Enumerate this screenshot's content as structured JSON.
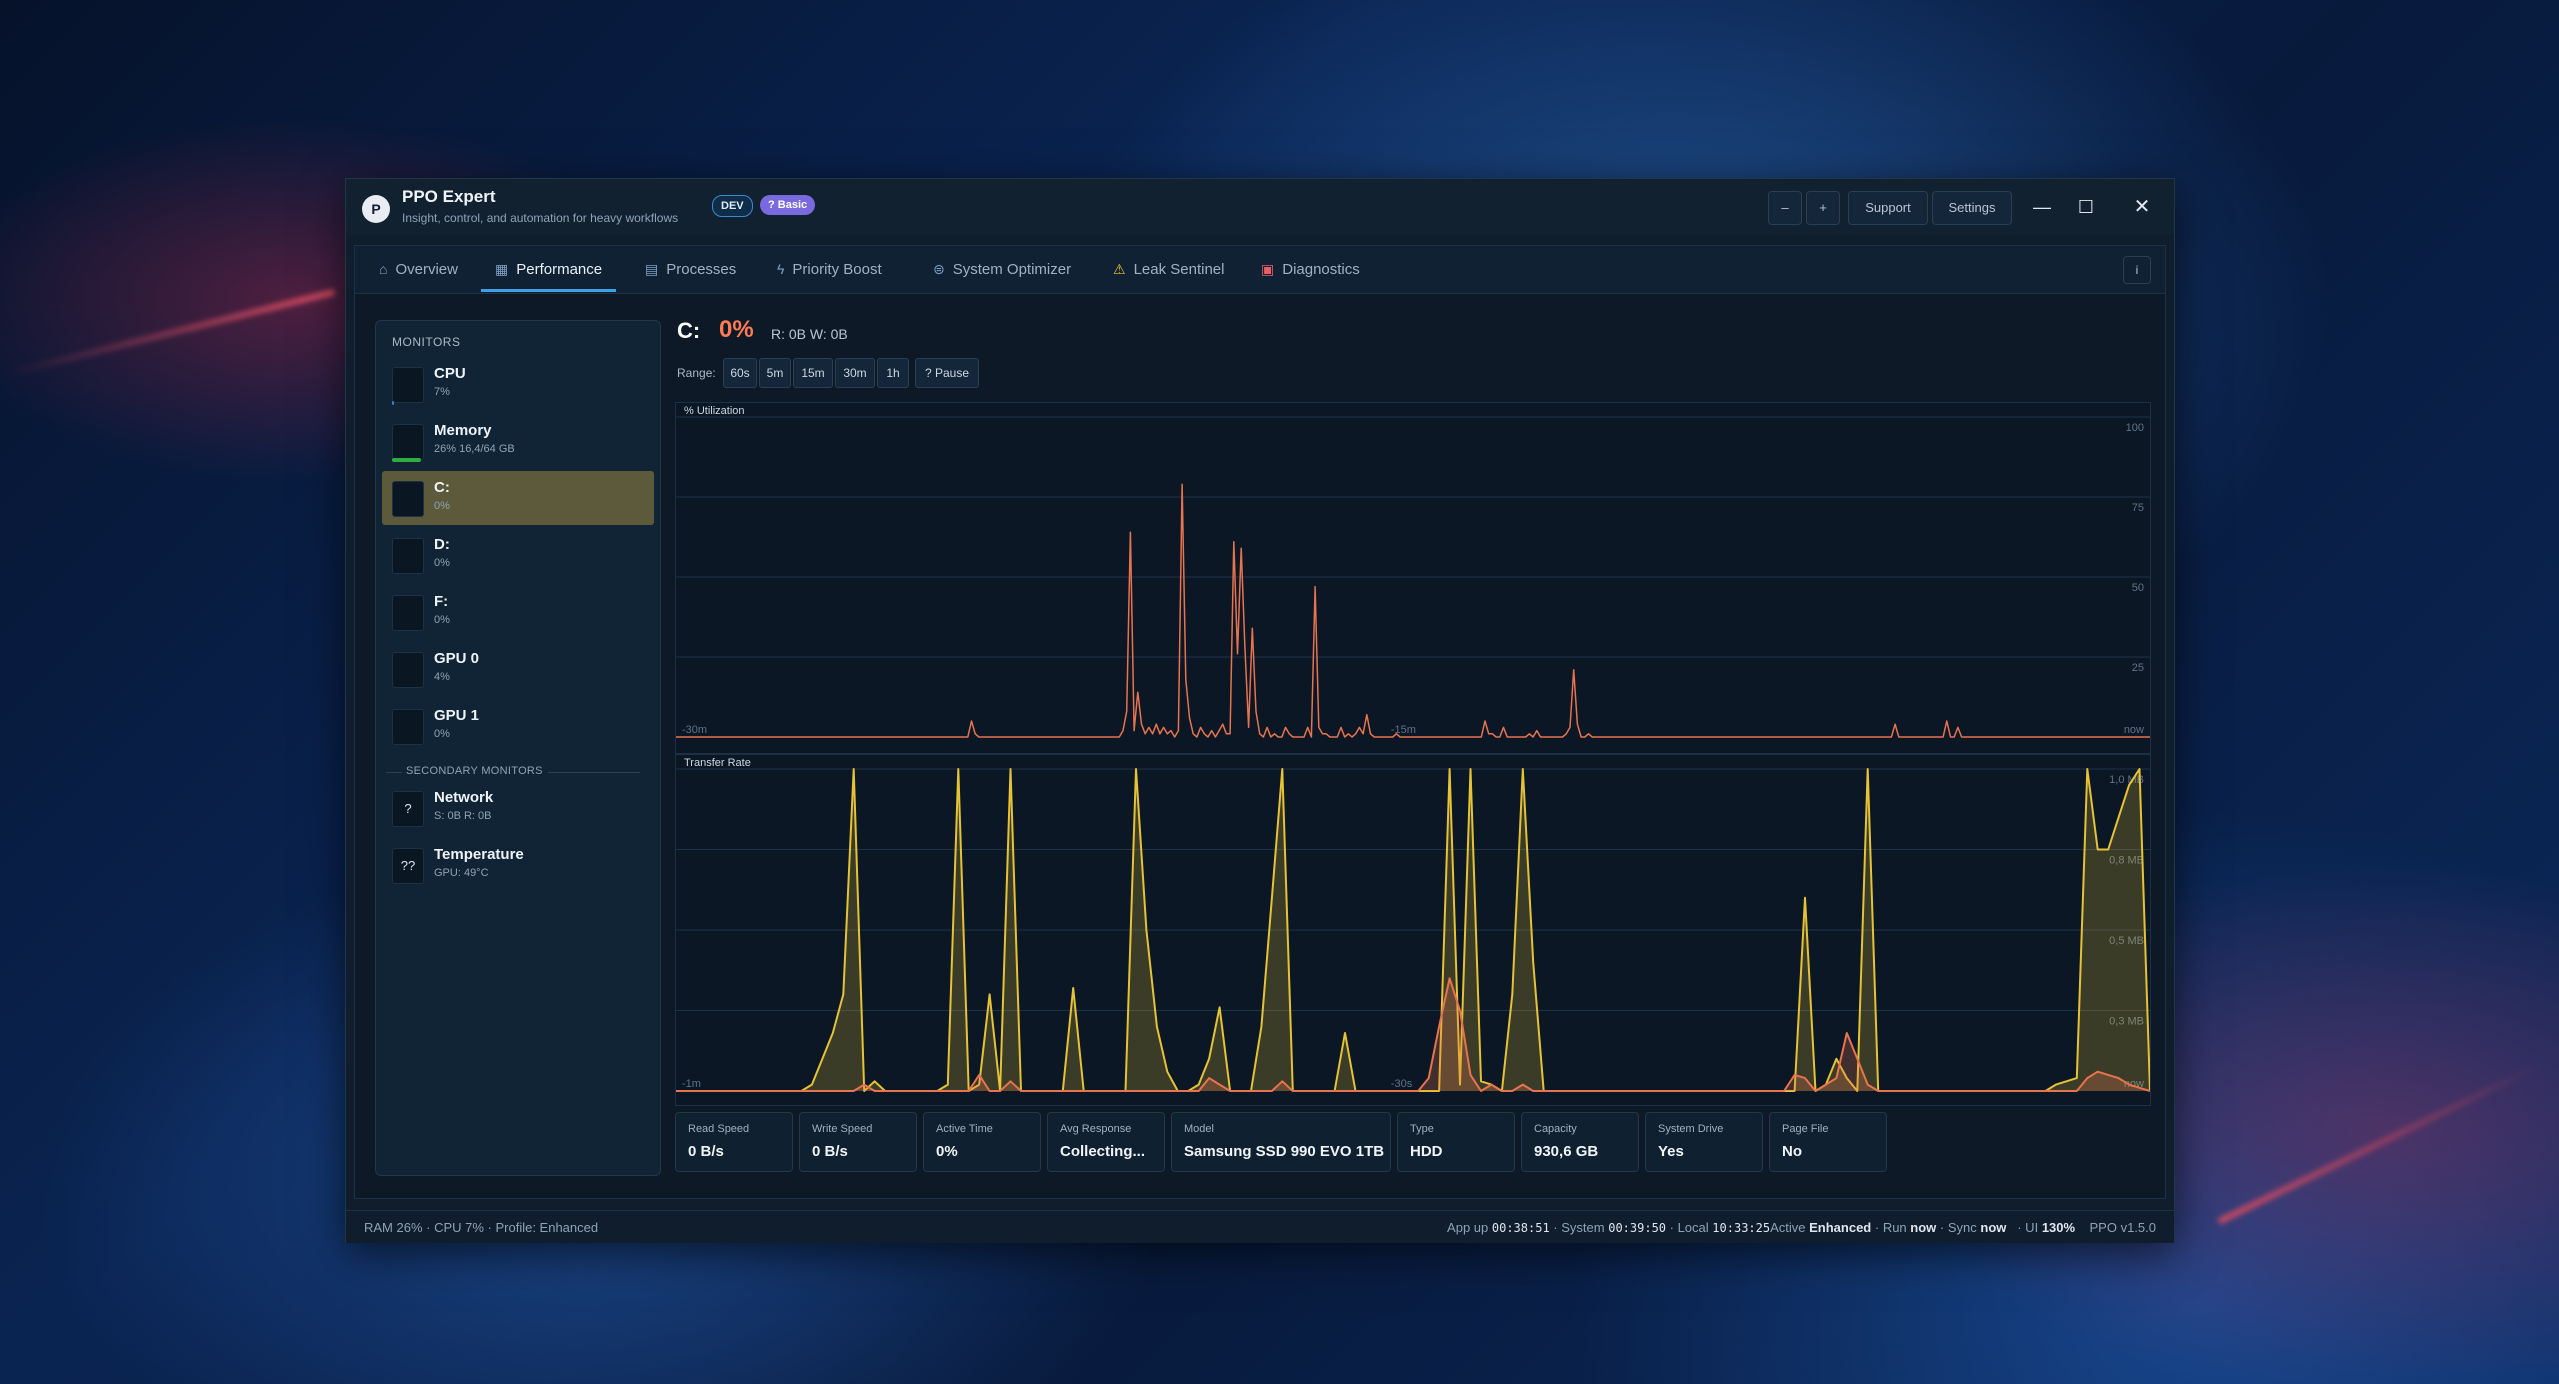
{
  "window": {
    "app_title": "PPO Expert",
    "subtitle": "Insight, control, and automation for heavy workflows",
    "logo_letter": "P",
    "badges": {
      "dev": "DEV",
      "basic": "? Basic"
    },
    "toolbar": {
      "zoom_out": "–",
      "zoom_in": "+",
      "support": "Support",
      "settings": "Settings"
    },
    "controls": {
      "minimize": "—",
      "maximize": "☐",
      "close": "✕"
    }
  },
  "tabs": [
    {
      "label": "Overview",
      "icon": "home-icon",
      "glyph": "⌂"
    },
    {
      "label": "Performance",
      "icon": "chart-icon",
      "glyph": "▦"
    },
    {
      "label": "Processes",
      "icon": "document-icon",
      "glyph": "▤"
    },
    {
      "label": "Priority Boost",
      "icon": "bolt-icon",
      "glyph": "ϟ"
    },
    {
      "label": "System Optimizer",
      "icon": "gamepad-icon",
      "glyph": "⊜"
    },
    {
      "label": "Leak Sentinel",
      "icon": "warning-icon",
      "glyph": "⚠"
    },
    {
      "label": "Diagnostics",
      "icon": "toolbox-icon",
      "glyph": "▣"
    }
  ],
  "info_button": "i",
  "sidebar": {
    "heading": "MONITORS",
    "monitors": [
      {
        "name": "CPU",
        "value": "7%",
        "bar_fraction": 0.07,
        "bar_color": "#3a7bd5"
      },
      {
        "name": "Memory",
        "value": "26%  16,4/64 GB",
        "bar_fraction": 0.9,
        "bar_color": "#2fae3f"
      },
      {
        "name": "C:",
        "value": "0%",
        "selected": true
      },
      {
        "name": "D:",
        "value": "0%"
      },
      {
        "name": "F:",
        "value": "0%"
      },
      {
        "name": "GPU 0",
        "value": "4%"
      },
      {
        "name": "GPU 1",
        "value": "0%"
      }
    ],
    "secondary_heading": "SECONDARY MONITORS",
    "secondary": [
      {
        "name": "Network",
        "value": "S: 0B  R: 0B",
        "glyph": "?"
      },
      {
        "name": "Temperature",
        "value": "GPU: 49°C",
        "glyph": "??"
      }
    ]
  },
  "detail": {
    "drive": "C:",
    "percent": "0%",
    "rw": "R: 0B   W: 0B",
    "range_label": "Range:",
    "ranges": [
      "60s",
      "5m",
      "15m",
      "30m",
      "1h",
      "? Pause"
    ]
  },
  "colors": {
    "utilization": "#e8734f",
    "transfer": "#e6c235",
    "accent": "#3ea0e6"
  },
  "chart_data": [
    {
      "type": "line",
      "title": "% Utilization",
      "ylim": [
        0,
        100
      ],
      "y_ticks": [
        "100",
        "75",
        "50",
        "25"
      ],
      "x_labels": [
        "-30m",
        "-15m",
        "now"
      ],
      "series": [
        {
          "values": [
            0,
            0,
            0,
            0,
            0,
            0,
            0,
            0,
            0,
            0,
            0,
            0,
            0,
            0,
            0,
            0,
            0,
            0,
            0,
            0,
            0,
            0,
            0,
            0,
            0,
            0,
            0,
            0,
            0,
            0,
            0,
            0,
            0,
            0,
            0,
            0,
            0,
            0,
            0,
            0,
            0,
            0,
            0,
            0,
            0,
            0,
            0,
            0,
            0,
            0,
            0,
            0,
            0,
            0,
            0,
            0,
            0,
            0,
            0,
            0,
            0,
            0,
            0,
            0,
            0,
            0,
            0,
            0,
            0,
            0,
            0,
            0,
            0,
            0,
            0,
            0,
            0,
            0,
            0,
            0,
            5,
            1,
            0,
            0,
            0,
            0,
            0,
            0,
            0,
            0,
            0,
            0,
            0,
            0,
            0,
            0,
            0,
            0,
            0,
            0,
            0,
            0,
            0,
            0,
            0,
            0,
            0,
            0,
            0,
            0,
            0,
            0,
            0,
            0,
            0,
            0,
            0,
            0,
            0,
            0,
            0,
            2,
            8,
            64,
            2,
            14,
            4,
            1,
            3,
            1,
            4,
            1,
            3,
            1,
            2,
            0,
            2,
            79,
            18,
            6,
            1,
            0,
            3,
            1,
            0,
            2,
            0,
            2,
            4,
            1,
            1,
            61,
            26,
            59,
            28,
            3,
            34,
            8,
            1,
            0,
            3,
            0,
            1,
            0,
            0,
            3,
            1,
            0,
            0,
            0,
            0,
            3,
            0,
            47,
            3,
            1,
            1,
            0,
            0,
            0,
            3,
            0,
            1,
            0,
            1,
            3,
            1,
            7,
            1,
            0,
            0,
            0,
            0,
            0,
            0,
            1,
            0,
            0,
            0,
            0,
            0,
            0,
            0,
            0,
            0,
            0,
            0,
            0,
            0,
            0,
            0,
            0,
            0,
            0,
            0,
            0,
            0,
            0,
            0,
            5,
            1,
            1,
            0,
            0,
            3,
            0,
            0,
            0,
            0,
            0,
            0,
            1,
            0,
            2,
            0,
            0,
            0,
            0,
            0,
            0,
            0,
            1,
            3,
            21,
            4,
            0,
            0,
            1,
            0,
            0,
            0,
            0,
            0,
            0,
            0,
            0,
            0,
            0,
            0,
            0,
            0,
            0,
            0,
            0,
            0,
            0,
            0,
            0,
            0,
            0,
            0,
            0,
            0,
            0,
            0,
            0,
            0,
            0,
            0,
            0,
            0,
            0,
            0,
            0,
            0,
            0,
            0,
            0,
            0,
            0,
            0,
            0,
            0,
            0,
            0,
            0,
            0,
            0,
            0,
            0,
            0,
            0,
            0,
            0,
            0,
            0,
            0,
            0,
            0,
            0,
            0,
            0,
            0,
            0,
            0,
            0,
            0,
            0,
            0,
            0,
            0,
            0,
            0,
            0,
            0,
            0,
            0,
            0,
            0,
            0,
            4,
            0,
            0,
            0,
            0,
            0,
            0,
            0,
            0,
            0,
            0,
            0,
            0,
            0,
            5,
            0,
            0,
            3,
            0,
            0,
            0,
            0,
            0,
            0,
            0,
            0,
            0,
            0,
            0,
            0,
            0,
            0,
            0,
            0,
            0,
            0,
            0,
            0,
            0,
            0,
            0,
            0,
            0,
            0,
            0,
            0,
            0,
            0,
            0,
            0,
            0,
            0,
            0,
            0,
            0,
            0,
            0,
            0,
            0,
            0,
            0,
            0,
            0,
            0,
            0,
            0,
            0,
            0,
            0,
            0
          ]
        }
      ]
    },
    {
      "type": "area",
      "title": "Transfer Rate",
      "ylim": [
        0,
        1.0
      ],
      "y_ticks": [
        "1,0 MB",
        "0,8 MB",
        "0,5 MB",
        "0,3 MB"
      ],
      "x_labels": [
        "-1m",
        "-30s",
        "now"
      ],
      "series": [
        {
          "name": "read",
          "values": [
            0,
            0,
            0,
            0,
            0,
            0,
            0,
            0,
            0,
            0,
            0,
            0,
            0,
            0.02,
            0.1,
            0.18,
            0.3,
            1.0,
            0,
            0.03,
            0,
            0,
            0,
            0,
            0,
            0,
            0.02,
            1.0,
            0,
            0.02,
            0.3,
            0,
            1.0,
            0,
            0,
            0,
            0,
            0,
            0.32,
            0,
            0,
            0,
            0,
            0,
            1.0,
            0.5,
            0.2,
            0.06,
            0,
            0,
            0.02,
            0.1,
            0.26,
            0,
            0,
            0,
            0.2,
            0.6,
            1.0,
            0,
            0,
            0,
            0,
            0,
            0.18,
            0,
            0,
            0,
            0,
            0,
            0,
            0,
            0,
            0,
            1.0,
            0.02,
            1.0,
            0.03,
            0.02,
            0,
            0.3,
            1.0,
            0.4,
            0,
            0,
            0,
            0,
            0,
            0,
            0,
            0,
            0,
            0,
            0,
            0,
            0,
            0,
            0,
            0,
            0,
            0,
            0,
            0,
            0,
            0,
            0,
            0,
            0,
            0.6,
            0,
            0.02,
            0.1,
            0.04,
            0,
            1.0,
            0,
            0,
            0,
            0,
            0,
            0,
            0,
            0,
            0,
            0,
            0,
            0,
            0,
            0,
            0,
            0,
            0,
            0.02,
            0.03,
            0.04,
            1.0,
            0.75,
            0.75,
            0.85,
            0.95,
            1.0,
            0
          ]
        },
        {
          "name": "write",
          "values": [
            0,
            0,
            0,
            0,
            0,
            0,
            0,
            0,
            0,
            0,
            0,
            0,
            0,
            0,
            0,
            0,
            0,
            0,
            0.02,
            0,
            0,
            0,
            0,
            0,
            0,
            0,
            0,
            0,
            0,
            0.05,
            0,
            0,
            0.03,
            0,
            0,
            0,
            0,
            0,
            0,
            0,
            0,
            0,
            0,
            0,
            0,
            0,
            0,
            0,
            0,
            0,
            0,
            0.04,
            0.02,
            0,
            0,
            0,
            0,
            0,
            0.03,
            0,
            0,
            0,
            0,
            0,
            0,
            0,
            0,
            0,
            0,
            0,
            0,
            0,
            0.04,
            0.2,
            0.35,
            0.25,
            0.05,
            0,
            0.02,
            0,
            0,
            0.02,
            0,
            0,
            0,
            0,
            0,
            0,
            0,
            0,
            0,
            0,
            0,
            0,
            0,
            0,
            0,
            0,
            0,
            0,
            0,
            0,
            0,
            0,
            0,
            0,
            0,
            0.05,
            0.04,
            0,
            0.02,
            0.04,
            0.18,
            0.1,
            0.02,
            0,
            0,
            0,
            0,
            0,
            0,
            0,
            0,
            0,
            0,
            0,
            0,
            0,
            0,
            0,
            0,
            0,
            0,
            0,
            0,
            0.04,
            0.06,
            0.05,
            0.04,
            0.02,
            0.01,
            0
          ]
        }
      ]
    }
  ],
  "cards": [
    {
      "label": "Read Speed",
      "value": "0 B/s"
    },
    {
      "label": "Write Speed",
      "value": "0 B/s"
    },
    {
      "label": "Active Time",
      "value": "0%"
    },
    {
      "label": "Avg Response",
      "value": "Collecting..."
    },
    {
      "label": "Model",
      "value": "Samsung SSD 990 EVO 1TB"
    },
    {
      "label": "Type",
      "value": "HDD"
    },
    {
      "label": "Capacity",
      "value": "930,6 GB"
    },
    {
      "label": "System Drive",
      "value": "Yes"
    },
    {
      "label": "Page File",
      "value": "No"
    }
  ],
  "status": {
    "left": "RAM 26%  ·  CPU 7%  ·  Profile: Enhanced",
    "app_up_label": "App up",
    "app_up": "00:38:51",
    "system_label": "· System",
    "system": "00:39:50",
    "local_label": "· Local",
    "local": "10:33:25",
    "active_label": "Active",
    "active": "Enhanced",
    "run_label": "· Run",
    "run": "now",
    "sync_label": "· Sync",
    "sync": "now",
    "ui_label": "· UI",
    "ui": "130%",
    "version": "PPO v1.5.0"
  }
}
